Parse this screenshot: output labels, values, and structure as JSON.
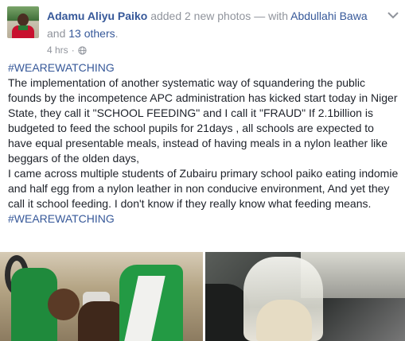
{
  "post": {
    "author": "Adamu Aliyu Paiko",
    "action": "added 2 new photos",
    "with_prefix": "— with",
    "tagged_person": "Abdullahi Bawa",
    "and_word": "and",
    "others": "13 others",
    "period": ".",
    "time": "4 hrs",
    "time_separator": "·",
    "audience_icon": "globe-icon",
    "options_icon": "chevron-down-icon"
  },
  "body": {
    "hashtag_top": "#WEAREWATCHING",
    "paragraph_1": "The implementation of another systematic way of squandering the public founds by the incompetence APC administration has kicked start today in Niger State, they call it \"SCHOOL FEEDING\" and I call it \"FRAUD\" If 2.1billion is budgeted to feed the school pupils for 21days , all schools are expected to have equal presentable meals, instead of having meals in a nylon leather like beggars of the olden days,",
    "paragraph_2": "I came across multiple students of Zubairu primary school paiko eating indomie and half egg from a nylon leather in non conducive environment, And yet they call it school feeding. I don't know if they really know what feeding means.",
    "hashtag_bottom": "#WEAREWATCHING"
  },
  "photos": [
    {
      "name": "photo-students-in-green-uniforms"
    },
    {
      "name": "photo-food-in-nylon-bag"
    }
  ],
  "colors": {
    "link": "#365899",
    "muted": "#90949c",
    "text": "#1d2129"
  }
}
